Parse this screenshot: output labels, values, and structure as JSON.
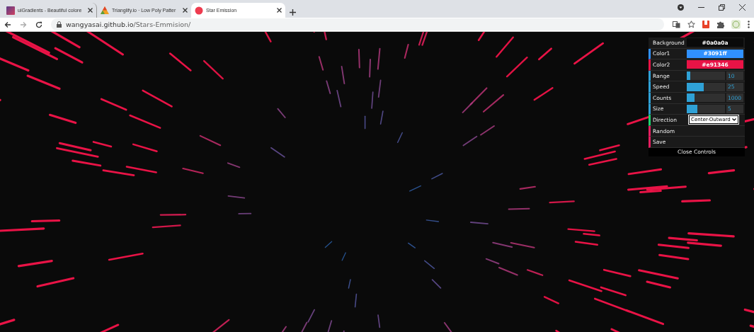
{
  "browser": {
    "tabs": [
      {
        "title": "uiGradients - Beautiful colore",
        "selected": false
      },
      {
        "title": "Trianglify.io · Low Poly Patter",
        "selected": false
      },
      {
        "title": "Star Emission",
        "selected": true
      }
    ],
    "url": {
      "host": "wangyasai.github.io",
      "path": "/Stars-Emmision/"
    }
  },
  "controls": {
    "rows": [
      {
        "kind": "color",
        "label": "Background",
        "value": "#0a0a0a",
        "color": "#0a0a0a"
      },
      {
        "kind": "color",
        "label": "Color1",
        "value": "#3091ff",
        "color": "#3091ff"
      },
      {
        "kind": "color",
        "label": "Color2",
        "value": "#e91346",
        "color": "#e91346"
      },
      {
        "kind": "slider",
        "label": "Range",
        "value": "10",
        "level": 0.1
      },
      {
        "kind": "slider",
        "label": "Speed",
        "value": "25",
        "level": 0.45
      },
      {
        "kind": "slider",
        "label": "Counts",
        "value": "1000",
        "level": 0.2
      },
      {
        "kind": "slider",
        "label": "Size",
        "value": "5",
        "level": 0.27
      },
      {
        "kind": "select",
        "label": "Direction",
        "value": "Center-Outward"
      },
      {
        "kind": "button",
        "label": "Random"
      },
      {
        "kind": "button",
        "label": "Save"
      }
    ],
    "close_label": "Close Controls"
  }
}
